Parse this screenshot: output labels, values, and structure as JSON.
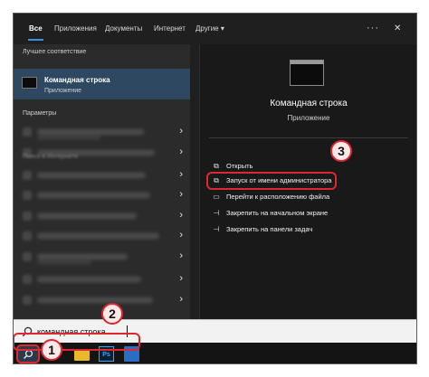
{
  "tabs": [
    {
      "label": "Все",
      "active": true
    },
    {
      "label": "Приложения",
      "active": false
    },
    {
      "label": "Документы",
      "active": false
    },
    {
      "label": "Интернет",
      "active": false
    },
    {
      "label": "Другие ▾",
      "active": false
    }
  ],
  "tabbar": {
    "more": "···",
    "close": "✕"
  },
  "left": {
    "best_match_title": "Лучшее соответствие",
    "best_match": {
      "title": "Командная строка",
      "subtitle": "Приложение"
    },
    "params_title": "Параметры",
    "web_title": "Поиск в Интернете"
  },
  "right": {
    "title": "Командная строка",
    "subtitle": "Приложение",
    "actions": [
      {
        "label": "Открыть",
        "icon": "open-icon"
      },
      {
        "label": "Запуск от имени администратора",
        "icon": "run-as-admin-icon"
      },
      {
        "label": "Перейти к расположению файла",
        "icon": "folder-location-icon"
      },
      {
        "label": "Закрепить на начальном экране",
        "icon": "pin-icon"
      },
      {
        "label": "Закрепить на панели задач",
        "icon": "pin-icon"
      }
    ]
  },
  "search": {
    "value": "командная строка",
    "icon": "search-icon"
  },
  "taskbar": {
    "ps_label": "Ps"
  },
  "badges": {
    "one": "1",
    "two": "2",
    "three": "3"
  },
  "colors": {
    "accent": "#3a8ee6",
    "highlight": "#e0262f",
    "selected_row": "#2d4860"
  }
}
